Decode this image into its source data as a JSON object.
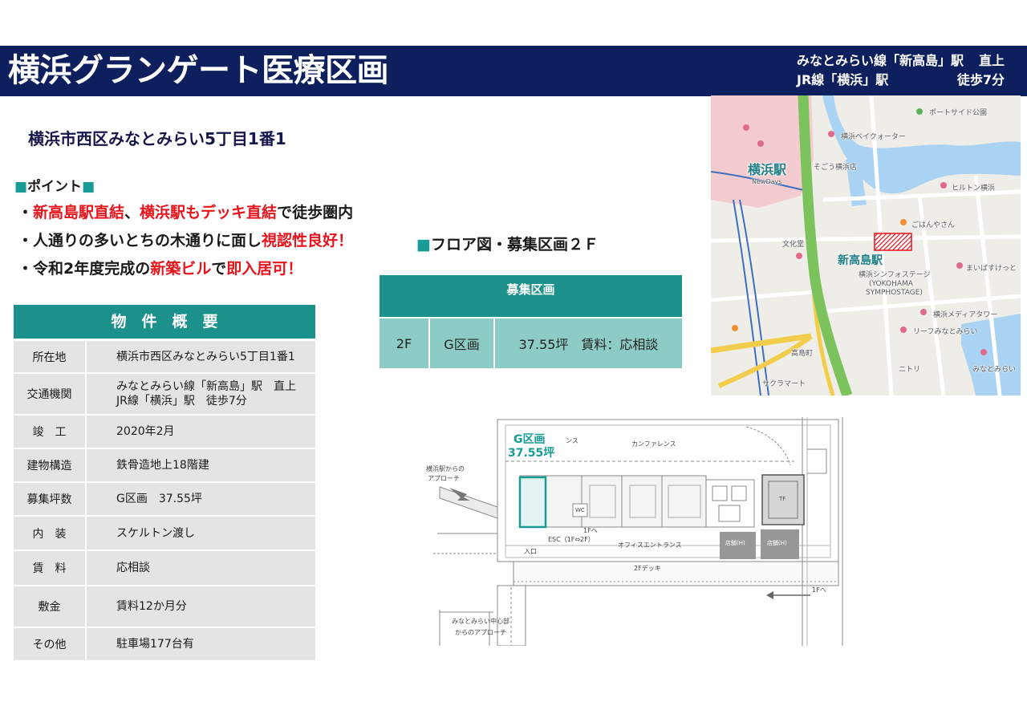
{
  "colors": {
    "navy": "#0d1f5c",
    "teal": "#1c918b",
    "light_teal": "#8dccc4",
    "highlight_red": "#e8141c",
    "table_gray": "#e4e4e4",
    "marker_teal": "#1a9c96"
  },
  "header": {
    "title": "横浜グランゲート医療区画",
    "access": [
      {
        "line": "みなとみらい線「新高島」駅",
        "note": "直上"
      },
      {
        "line": "JR線「横浜」駅",
        "note": "徒歩7分"
      }
    ]
  },
  "address": "横浜市西区みなとみらい5丁目1番1",
  "points": {
    "marker": "■",
    "heading": "ポイント",
    "lines": [
      {
        "segments": [
          {
            "text": "・",
            "highlight": false
          },
          {
            "text": "新高島駅直結",
            "highlight": true
          },
          {
            "text": "、",
            "highlight": false
          },
          {
            "text": "横浜駅もデッキ直結",
            "highlight": true
          },
          {
            "text": "で徒歩圏内",
            "highlight": false
          }
        ]
      },
      {
        "segments": [
          {
            "text": "・人通りの多いとちの木通りに面し",
            "highlight": false
          },
          {
            "text": "視認性良好！",
            "highlight": true
          }
        ]
      },
      {
        "segments": [
          {
            "text": "・令和2年度完成の",
            "highlight": false
          },
          {
            "text": "新築ビル",
            "highlight": true
          },
          {
            "text": "で",
            "highlight": false
          },
          {
            "text": "即入居可！",
            "highlight": true
          }
        ]
      }
    ]
  },
  "overview": {
    "title": "物　件　概　要",
    "rows": [
      {
        "label": "所在地",
        "values": [
          "横浜市西区みなとみらい5丁目1番1"
        ]
      },
      {
        "label": "交通機関",
        "values": [
          "みなとみらい線「新高島」駅　直上",
          "JR線「横浜」駅　徒歩7分"
        ]
      },
      {
        "label": "竣　工",
        "values": [
          "2020年2月"
        ]
      },
      {
        "label": "建物構造",
        "values": [
          "鉄骨造地上18階建"
        ]
      },
      {
        "label": "募集坪数",
        "values": [
          "G区画　37.55坪"
        ]
      },
      {
        "label": "内　装",
        "values": [
          "スケルトン渡し"
        ]
      },
      {
        "label": "賃　料",
        "values": [
          "応相談"
        ]
      },
      {
        "label": "敷金",
        "values": [
          "賃料12か月分"
        ]
      },
      {
        "label": "その他",
        "values": [
          "駐車場177台有"
        ]
      }
    ]
  },
  "floor": {
    "marker": "■",
    "heading": "フロア図・募集区画２Ｆ",
    "table": {
      "header": "募集区画",
      "floor": "2F",
      "section": "G区画",
      "detail": "37.55坪　賃料：応相談"
    }
  },
  "map": {
    "yokohama_station": "横浜駅",
    "newdays": "NewDays",
    "shin_takashima_station": "新高島駅",
    "bay_quarter": "横浜ベイクォーター",
    "portside_park": "ポートサイド公園",
    "sogo": "そごう横浜店",
    "hilton": "ヒルトン横浜",
    "gohanyasan": "ごはんやさん",
    "bunkado": "文化堂",
    "maibasuketto": "まいばすけっと",
    "symphostage_1": "横浜シンフォステージ",
    "symphostage_2": "(YOKOHAMA",
    "symphostage_3": "SYMPHOSTAGE)",
    "media_tower": "横浜メディアタワー",
    "leaf": "リーフみなとみらい",
    "takashimacho": "高島町",
    "nitori": "ニトリ",
    "minatomirai": "みなとみらい",
    "sakura_mart": "サクラマート"
  },
  "floor_plan": {
    "g_section": "G区画",
    "g_area": "37.55坪",
    "fragment": "ンス",
    "conference": "カンファレンス",
    "approach_yokohama_1": "横浜駅からの",
    "approach_yokohama_2": "アプローチ",
    "wc": "WC",
    "to_1f_a": "1Fへ",
    "escalator": "ESC（1F⇔2F）",
    "entrance": "入口",
    "office_entrance": "オフィスエントランス",
    "shop_1": "店舗(H)",
    "shop_2": "店舗(H)",
    "tf": "TF",
    "deck": "2Fデッキ",
    "to_1f_b": "1Fへ",
    "approach_mm_1": "みなとみらい中心部",
    "approach_mm_2": "からのアプローチ"
  }
}
